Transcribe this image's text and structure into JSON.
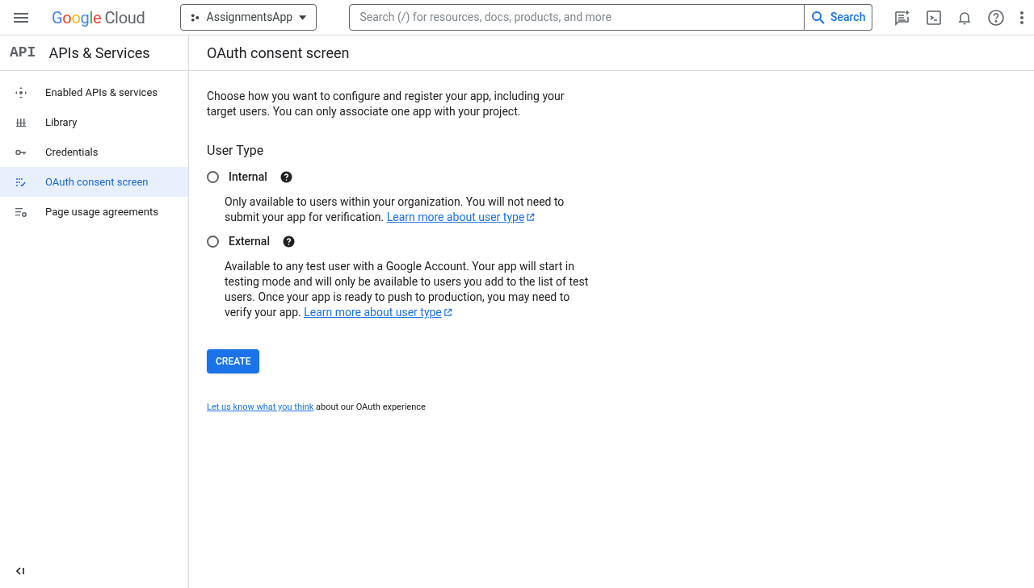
{
  "header": {
    "logo": {
      "brand": "Google",
      "product": "Cloud"
    },
    "project": "AssignmentsApp",
    "search": {
      "placeholder": "Search (/) for resources, docs, products, and more",
      "button": "Search"
    }
  },
  "sidebar": {
    "badge": "API",
    "title": "APIs & Services",
    "items": [
      {
        "label": "Enabled APIs & services",
        "kind": "dashboard",
        "selected": false
      },
      {
        "label": "Library",
        "kind": "library",
        "selected": false
      },
      {
        "label": "Credentials",
        "kind": "key",
        "selected": false
      },
      {
        "label": "OAuth consent screen",
        "kind": "consent",
        "selected": true
      },
      {
        "label": "Page usage agreements",
        "kind": "settings",
        "selected": false
      }
    ]
  },
  "page": {
    "title": "OAuth consent screen",
    "intro": "Choose how you want to configure and register your app, including your target users. You can only associate one app with your project.",
    "section": "User Type",
    "options": [
      {
        "label": "Internal",
        "selected": false,
        "description": "Only available to users within your organization. You will not need to submit your app for verification.",
        "link": "Learn more about user type"
      },
      {
        "label": "External",
        "selected": false,
        "description": "Available to any test user with a Google Account. Your app will start in testing mode and will only be available to users you add to the list of test users. Once your app is ready to push to production, you may need to verify your app.",
        "link": "Learn more about user type"
      }
    ],
    "create_button": "CREATE",
    "feedback": {
      "link": "Let us know what you think",
      "text": "about our OAuth experience"
    }
  }
}
